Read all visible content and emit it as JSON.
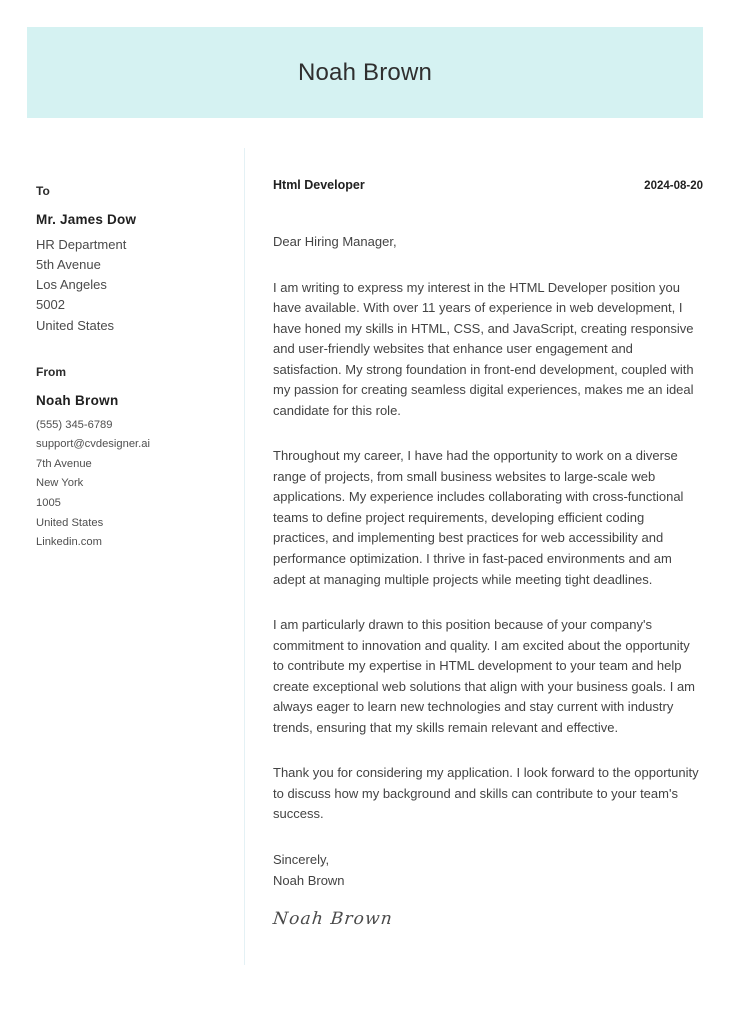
{
  "header": {
    "name": "Noah Brown",
    "background_color": "#d5f2f2"
  },
  "sidebar": {
    "to": {
      "label": "To",
      "name": "Mr. James Dow",
      "lines": [
        "HR Department",
        "5th Avenue",
        "Los Angeles",
        "5002",
        "United States"
      ]
    },
    "from": {
      "label": "From",
      "name": "Noah Brown",
      "lines": [
        "(555) 345-6789",
        "support@cvdesigner.ai",
        "7th Avenue",
        "New York",
        "1005",
        "United States",
        "Linkedin.com"
      ]
    }
  },
  "letter": {
    "job_title": "Html Developer",
    "date": "2024-08-20",
    "salutation": "Dear Hiring Manager,",
    "paragraphs": [
      "I am writing to express my interest in the HTML Developer position you have available. With over 11 years of experience in web development, I have honed my skills in HTML, CSS, and JavaScript, creating responsive and user-friendly websites that enhance user engagement and satisfaction. My strong foundation in front-end development, coupled with my passion for creating seamless digital experiences, makes me an ideal candidate for this role.",
      "Throughout my career, I have had the opportunity to work on a diverse range of projects, from small business websites to large-scale web applications. My experience includes collaborating with cross-functional teams to define project requirements, developing efficient coding practices, and implementing best practices for web accessibility and performance optimization. I thrive in fast-paced environments and am adept at managing multiple projects while meeting tight deadlines.",
      "I am particularly drawn to this position because of your company's commitment to innovation and quality. I am excited about the opportunity to contribute my expertise in HTML development to your team and help create exceptional web solutions that align with your business goals. I am always eager to learn new technologies and stay current with industry trends, ensuring that my skills remain relevant and effective.",
      "Thank you for considering my application. I look forward to the opportunity to discuss how my background and skills can contribute to your team's success."
    ],
    "closing_word": "Sincerely,",
    "closing_name": "Noah Brown",
    "signature": "Noah Brown"
  }
}
